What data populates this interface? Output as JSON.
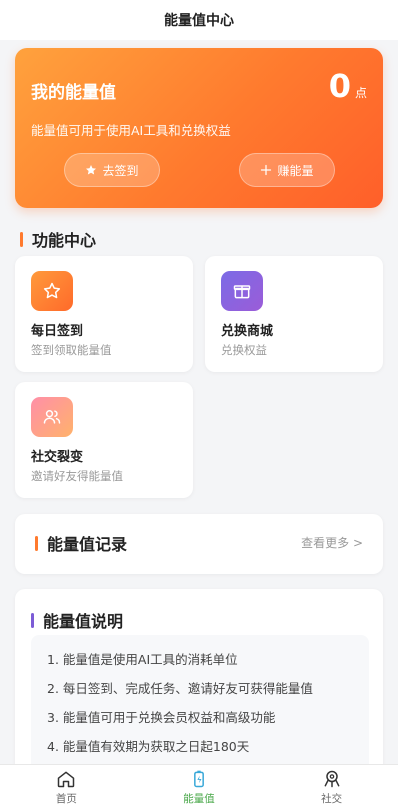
{
  "header": {
    "title": "能量值中心"
  },
  "energy_card": {
    "title": "我的能量值",
    "points": "0",
    "unit": "点",
    "description": "能量值可用于使用AI工具和兑换权益",
    "signin_label": "去签到",
    "earn_label": "赚能量"
  },
  "features": {
    "title": "功能中心",
    "items": [
      {
        "name": "每日签到",
        "sub": "签到领取能量值",
        "icon": "star-icon"
      },
      {
        "name": "兑换商城",
        "sub": "兑换权益",
        "icon": "gift-icon"
      },
      {
        "name": "社交裂变",
        "sub": "邀请好友得能量值",
        "icon": "users-icon"
      }
    ]
  },
  "records": {
    "title": "能量值记录",
    "view_more": "查看更多 >"
  },
  "explanation": {
    "title": "能量值说明",
    "items": [
      "1. 能量值是使用AI工具的消耗单位",
      "2. 每日签到、完成任务、邀请好友可获得能量值",
      "3. 能量值可用于兑换会员权益和高级功能",
      "4. 能量值有效期为获取之日起180天"
    ]
  },
  "tabbar": {
    "items": [
      {
        "label": "首页",
        "icon": "home-icon"
      },
      {
        "label": "能量值",
        "icon": "battery-icon",
        "active": true
      },
      {
        "label": "社交",
        "icon": "social-icon"
      }
    ]
  },
  "colors": {
    "accent": "#ff7a2e",
    "active_tab": "#4aa84a",
    "purple": "#7c5cd6"
  }
}
